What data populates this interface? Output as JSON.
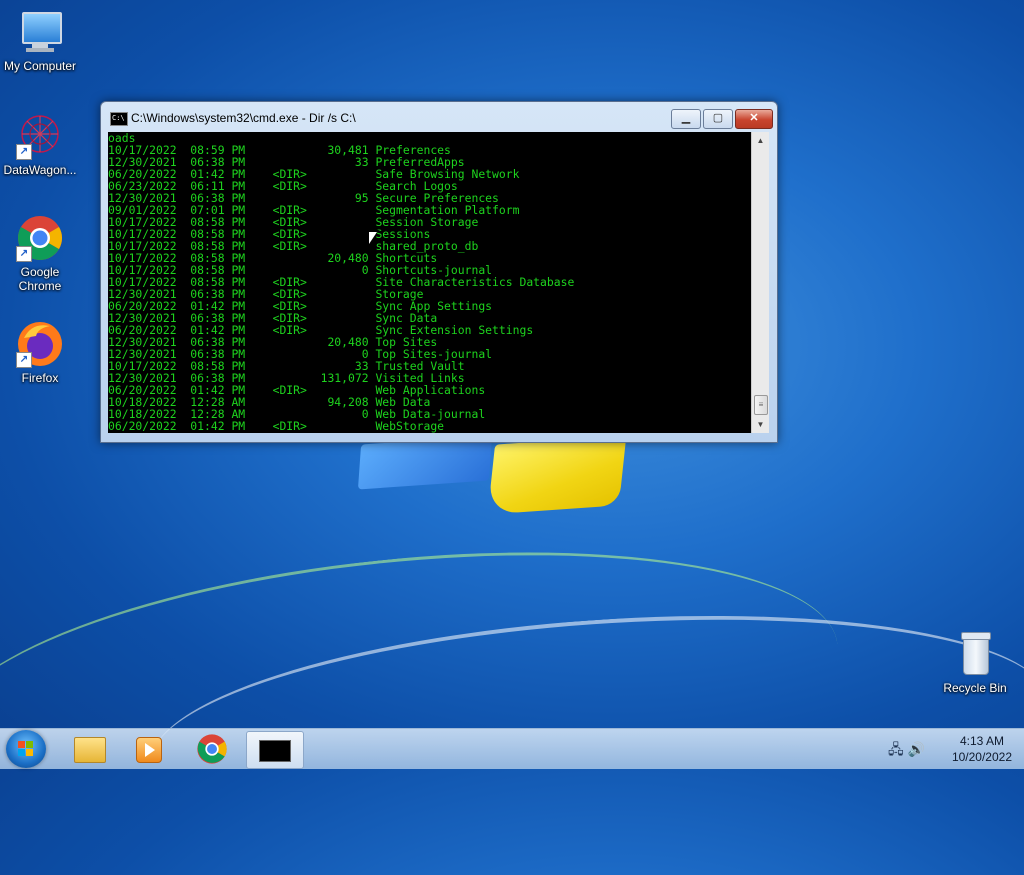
{
  "desktop": {
    "icons": [
      {
        "label": "My Computer"
      },
      {
        "label": "DataWagon..."
      },
      {
        "label": "Google Chrome"
      },
      {
        "label": "Firefox"
      },
      {
        "label": "Recycle Bin"
      }
    ]
  },
  "cmd_window": {
    "title": "C:\\Windows\\system32\\cmd.exe - Dir /s C:\\",
    "controls": {
      "minimize": "▁",
      "maximize": "▢",
      "close": "✕"
    },
    "lines": [
      "oads",
      "10/17/2022  08:59 PM            30,481 Preferences",
      "12/30/2021  06:38 PM                33 PreferredApps",
      "06/20/2022  01:42 PM    <DIR>          Safe Browsing Network",
      "06/23/2022  06:11 PM    <DIR>          Search Logos",
      "12/30/2021  06:38 PM                95 Secure Preferences",
      "09/01/2022  07:01 PM    <DIR>          Segmentation Platform",
      "10/17/2022  08:58 PM    <DIR>          Session Storage",
      "10/17/2022  08:58 PM    <DIR>          Sessions",
      "10/17/2022  08:58 PM    <DIR>          shared_proto_db",
      "10/17/2022  08:58 PM            20,480 Shortcuts",
      "10/17/2022  08:58 PM                 0 Shortcuts-journal",
      "10/17/2022  08:58 PM    <DIR>          Site Characteristics Database",
      "12/30/2021  06:38 PM    <DIR>          Storage",
      "06/20/2022  01:42 PM    <DIR>          Sync App Settings",
      "12/30/2021  06:38 PM    <DIR>          Sync Data",
      "06/20/2022  01:42 PM    <DIR>          Sync Extension Settings",
      "12/30/2021  06:38 PM            20,480 Top Sites",
      "12/30/2021  06:38 PM                 0 Top Sites-journal",
      "10/17/2022  08:58 PM                33 Trusted Vault",
      "12/30/2021  06:38 PM           131,072 Visited Links",
      "06/20/2022  01:42 PM    <DIR>          Web Applications",
      "10/18/2022  12:28 AM            94,208 Web Data",
      "10/18/2022  12:28 AM                 0 Web Data-journal",
      "06/20/2022  01:42 PM    <DIR>          WebStorage"
    ]
  },
  "taskbar": {
    "clock_time": "4:13 AM",
    "clock_date": "10/20/2022",
    "pinned": [
      "Windows Explorer",
      "Windows Media Player",
      "Google Chrome",
      "Command Prompt"
    ]
  },
  "colors": {
    "console_text": "#1ed31e",
    "console_bg": "#000000"
  }
}
